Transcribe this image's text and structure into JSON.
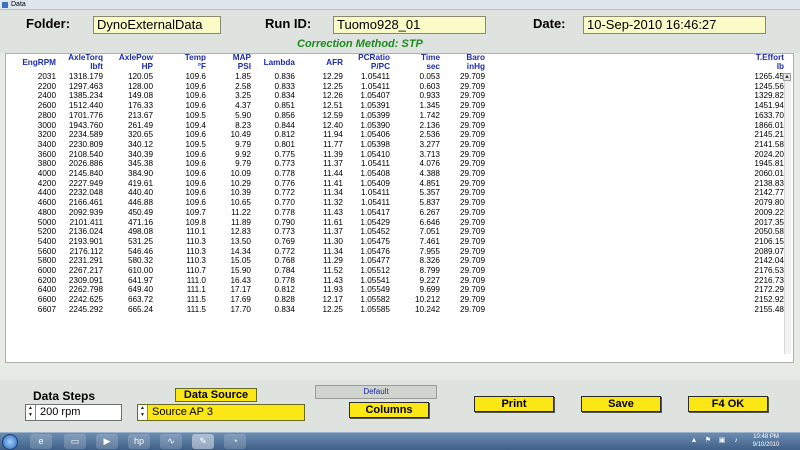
{
  "window": {
    "title": "Data"
  },
  "header": {
    "folder_label": "Folder:",
    "folder_value": "DynoExternalData",
    "runid_label": "Run ID:",
    "runid_value": "Tuomo928_01",
    "date_label": "Date:",
    "date_value": "10-Sep-2010  16:46:27",
    "correction": "Correction Method: STP"
  },
  "table": {
    "columns": [
      {
        "name": "EngRPM",
        "unit": ""
      },
      {
        "name": "AxleTorq",
        "unit": "lbft"
      },
      {
        "name": "AxlePow",
        "unit": "HP"
      },
      {
        "name": "Temp",
        "unit": "°F"
      },
      {
        "name": "MAP",
        "unit": "PSI"
      },
      {
        "name": "Lambda",
        "unit": ""
      },
      {
        "name": "AFR",
        "unit": ""
      },
      {
        "name": "PCRatio",
        "unit": "P/PC"
      },
      {
        "name": "Time",
        "unit": "sec"
      },
      {
        "name": "Baro",
        "unit": "inHg"
      },
      {
        "name": "T.Effort",
        "unit": "lb"
      }
    ],
    "rows": [
      [
        "2031",
        "1318.179",
        "120.05",
        "109.6",
        "1.85",
        "0.836",
        "12.29",
        "1.05411",
        "0.053",
        "29.709",
        "1265.45"
      ],
      [
        "2200",
        "1297.463",
        "128.00",
        "109.6",
        "2.58",
        "0.833",
        "12.25",
        "1.05411",
        "0.603",
        "29.709",
        "1245.56"
      ],
      [
        "2400",
        "1385.234",
        "149.08",
        "109.6",
        "3.25",
        "0.834",
        "12.26",
        "1.05407",
        "0.933",
        "29.709",
        "1329.82"
      ],
      [
        "2600",
        "1512.440",
        "176.33",
        "109.6",
        "4.37",
        "0.851",
        "12.51",
        "1.05391",
        "1.345",
        "29.709",
        "1451.94"
      ],
      [
        "2800",
        "1701.776",
        "213.67",
        "109.5",
        "5.90",
        "0.856",
        "12.59",
        "1.05399",
        "1.742",
        "29.709",
        "1633.70"
      ],
      [
        "3000",
        "1943.760",
        "261.49",
        "109.4",
        "8.23",
        "0.844",
        "12.40",
        "1.05390",
        "2.136",
        "29.709",
        "1866.01"
      ],
      [
        "3200",
        "2234.589",
        "320.65",
        "109.6",
        "10.49",
        "0.812",
        "11.94",
        "1.05406",
        "2.536",
        "29.709",
        "2145.21"
      ],
      [
        "3400",
        "2230.809",
        "340.12",
        "109.5",
        "9.79",
        "0.801",
        "11.77",
        "1.05398",
        "3.277",
        "29.709",
        "2141.58"
      ],
      [
        "3600",
        "2108.540",
        "340.39",
        "109.6",
        "9.92",
        "0.775",
        "11.39",
        "1.05410",
        "3.713",
        "29.709",
        "2024.20"
      ],
      [
        "3800",
        "2026.886",
        "345.38",
        "109.6",
        "9.79",
        "0.773",
        "11.37",
        "1.05411",
        "4.076",
        "29.709",
        "1945.81"
      ],
      [
        "4000",
        "2145.840",
        "384.90",
        "109.6",
        "10.09",
        "0.778",
        "11.44",
        "1.05408",
        "4.388",
        "29.709",
        "2060.01"
      ],
      [
        "4200",
        "2227.949",
        "419.61",
        "109.6",
        "10.29",
        "0.776",
        "11.41",
        "1.05409",
        "4.851",
        "29.709",
        "2138.83"
      ],
      [
        "4400",
        "2232.048",
        "440.40",
        "109.6",
        "10.39",
        "0.772",
        "11.34",
        "1.05411",
        "5.357",
        "29.709",
        "2142.77"
      ],
      [
        "4600",
        "2166.461",
        "446.88",
        "109.6",
        "10.65",
        "0.770",
        "11.32",
        "1.05411",
        "5.837",
        "29.709",
        "2079.80"
      ],
      [
        "4800",
        "2092.939",
        "450.49",
        "109.7",
        "11.22",
        "0.778",
        "11.43",
        "1.05417",
        "6.267",
        "29.709",
        "2009.22"
      ],
      [
        "5000",
        "2101.411",
        "471.16",
        "109.8",
        "11.89",
        "0.790",
        "11.61",
        "1.05429",
        "6.646",
        "29.709",
        "2017.35"
      ],
      [
        "5200",
        "2136.024",
        "498.08",
        "110.1",
        "12.83",
        "0.773",
        "11.37",
        "1.05452",
        "7.051",
        "29.709",
        "2050.58"
      ],
      [
        "5400",
        "2193.901",
        "531.25",
        "110.3",
        "13.50",
        "0.769",
        "11.30",
        "1.05475",
        "7.461",
        "29.709",
        "2106.15"
      ],
      [
        "5600",
        "2176.112",
        "546.46",
        "110.3",
        "14.34",
        "0.772",
        "11.34",
        "1.05476",
        "7.955",
        "29.709",
        "2089.07"
      ],
      [
        "5800",
        "2231.291",
        "580.32",
        "110.3",
        "15.05",
        "0.768",
        "11.29",
        "1.05477",
        "8.326",
        "29.709",
        "2142.04"
      ],
      [
        "6000",
        "2267.217",
        "610.00",
        "110.7",
        "15.90",
        "0.784",
        "11.52",
        "1.05512",
        "8.799",
        "29.709",
        "2176.53"
      ],
      [
        "6200",
        "2309.091",
        "641.97",
        "111.0",
        "16.43",
        "0.778",
        "11.43",
        "1.05541",
        "9.227",
        "29.709",
        "2216.73"
      ],
      [
        "6400",
        "2262.798",
        "649.40",
        "111.1",
        "17.17",
        "0.812",
        "11.93",
        "1.05549",
        "9.699",
        "29.709",
        "2172.29"
      ],
      [
        "6600",
        "2242.625",
        "663.72",
        "111.5",
        "17.69",
        "0.828",
        "12.17",
        "1.05582",
        "10.212",
        "29.709",
        "2152.92"
      ],
      [
        "6607",
        "2245.292",
        "665.24",
        "111.5",
        "17.70",
        "0.834",
        "12.25",
        "1.05585",
        "10.242",
        "29.709",
        "2155.48"
      ]
    ]
  },
  "footer": {
    "data_steps_label": "Data Steps",
    "data_steps_value": "200 rpm",
    "data_source_label": "Data Source",
    "data_source_value": "Source AP 3",
    "default_label": "Default",
    "columns_button": "Columns",
    "print_button": "Print",
    "save_button": "Save",
    "ok_button": "F4  OK"
  },
  "taskbar": {
    "time": "10:48 PM",
    "date": "9/10/2010",
    "apps": [
      "ie-icon",
      "folder-icon",
      "media-icon",
      "hp-icon",
      "chart-icon",
      "notepad-icon",
      "picture-icon"
    ]
  },
  "colors": {
    "header_label": "#1a2bb0",
    "yellow_button": "#fbe616",
    "field_bg": "#fbfbc8",
    "correction_green": "#1c8a1c"
  }
}
